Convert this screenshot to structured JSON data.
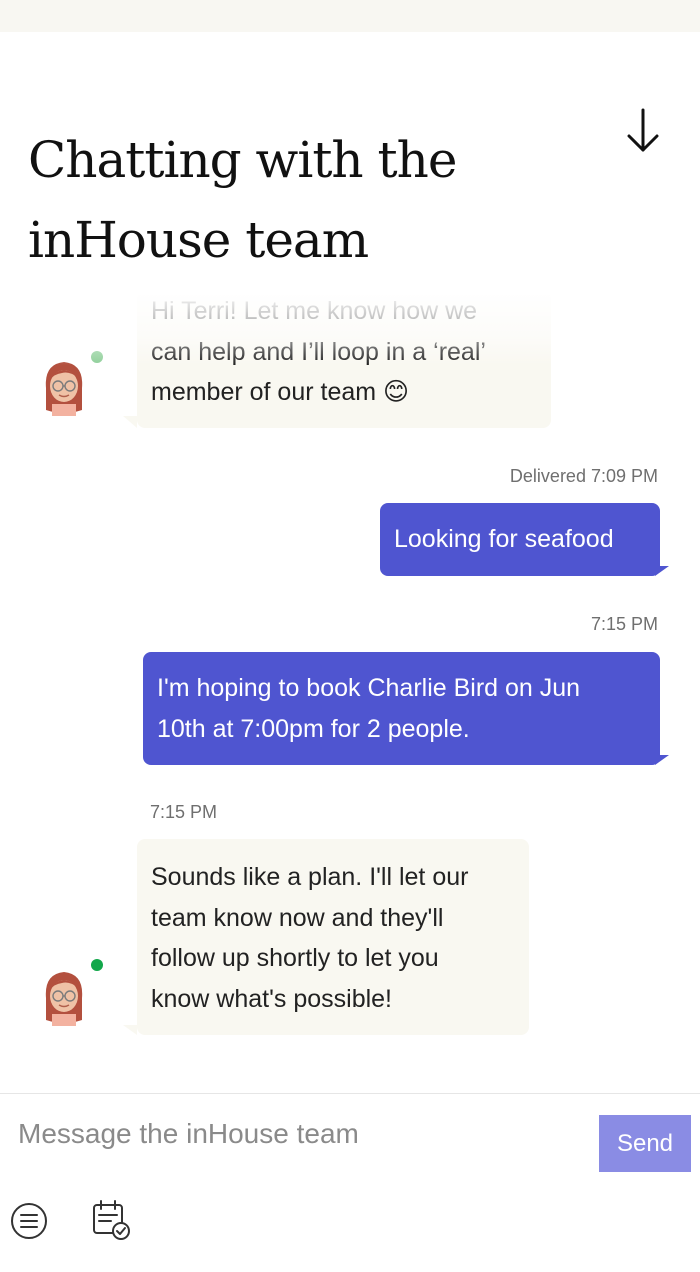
{
  "header": {
    "title": "Chatting with the inHouse team",
    "scroll_down_icon": "arrow-down-icon"
  },
  "messages": [
    {
      "sender": "bot",
      "lines": [
        "Hi Terri! Let me know how we",
        "can help and I’ll loop in a ‘real’",
        "member of our team"
      ],
      "emoji": "😊",
      "online_color": "#8fcf9a"
    },
    {
      "sender": "user",
      "status": "Delivered 7:09 PM",
      "lines": [
        "Looking for seafood"
      ]
    },
    {
      "sender": "user",
      "status": "7:15 PM",
      "lines": [
        "I'm hoping to book Charlie Bird on Jun",
        "10th at 7:00pm for 2 people."
      ]
    },
    {
      "sender": "bot",
      "status": "7:15 PM",
      "lines": [
        "Sounds like a plan. I'll let our",
        "team know now and they'll",
        "follow up shortly to let you",
        "know what's possible!"
      ],
      "online_color": "#12a74a"
    }
  ],
  "composer": {
    "placeholder": "Message the inHouse team",
    "send_label": "Send",
    "toolbar_icons": [
      "menu-icon",
      "calendar-check-icon"
    ]
  },
  "colors": {
    "user_bubble": "#4f55d0",
    "bot_bubble": "#f9f8f1",
    "send_button": "#8a8ce4"
  }
}
